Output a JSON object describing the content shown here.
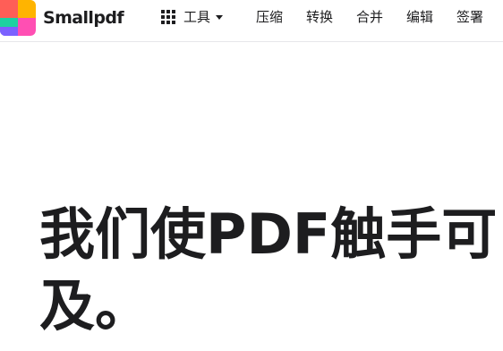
{
  "brand": {
    "name": "Smallpdf",
    "logo_colors": [
      "#ff5e57",
      "#ffb400",
      "#7b61ff",
      "#1dd1a1",
      "#ff4fb3"
    ]
  },
  "header": {
    "tools_label": "工具",
    "nav_items": [
      "压缩",
      "转换",
      "合并",
      "编辑",
      "签署"
    ]
  },
  "hero": {
    "title": "我们使PDF触手可及。"
  },
  "icons": {
    "tools": "grid-icon",
    "tools_dropdown": "caret-down-icon"
  }
}
